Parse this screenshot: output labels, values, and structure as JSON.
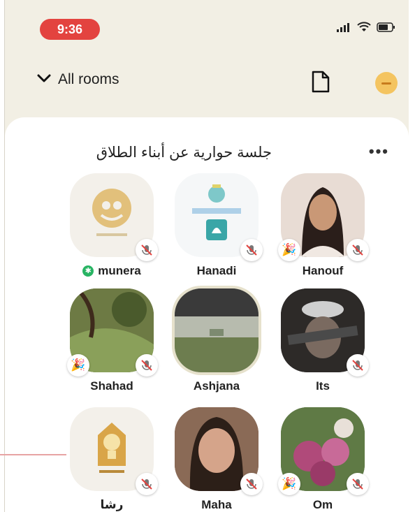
{
  "status_bar": {
    "time": "9:36",
    "signal_icon": "signal-bars-icon",
    "wifi_icon": "wifi-icon",
    "battery_icon": "battery-icon"
  },
  "header": {
    "rooms_label": "All rooms",
    "chevron_icon": "chevron-down-icon",
    "document_icon": "document-icon",
    "profile_icon": "profile-avatar-icon"
  },
  "room": {
    "title": "جلسة حوارية عن أبناء الطلاق",
    "more_label": "•••"
  },
  "speakers": [
    {
      "name": "munera",
      "moderator": true,
      "party": false,
      "muted": true
    },
    {
      "name": "Hanadi",
      "moderator": false,
      "party": false,
      "muted": true
    },
    {
      "name": "Hanouf",
      "moderator": false,
      "party": true,
      "muted": true
    },
    {
      "name": "Shahad",
      "moderator": false,
      "party": true,
      "muted": true
    },
    {
      "name": "Ashjana",
      "moderator": false,
      "party": false,
      "muted": false
    },
    {
      "name": "Its",
      "moderator": false,
      "party": false,
      "muted": true
    },
    {
      "name": "رشا",
      "moderator": false,
      "party": false,
      "muted": true
    },
    {
      "name": "Maha",
      "moderator": false,
      "party": false,
      "muted": true
    },
    {
      "name": "Om",
      "moderator": false,
      "party": true,
      "muted": true
    }
  ],
  "colors": {
    "background": "#f2efe4",
    "card": "#ffffff",
    "time_pill": "#e3433f",
    "moderator_badge": "#28b463",
    "profile": "#f4c460"
  }
}
